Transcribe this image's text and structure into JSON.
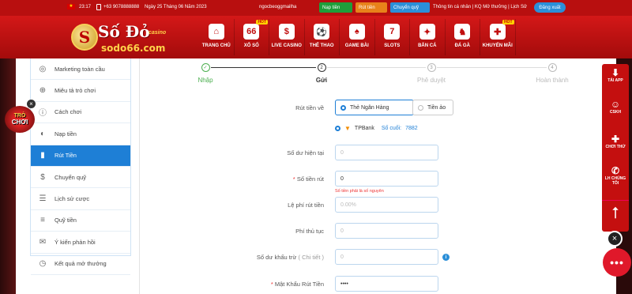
{
  "topbar": {
    "time": "23:17",
    "phone": "+63 9078888888",
    "date": "Ngày 25 Tháng 06 Năm 2023",
    "username": "ngocbeoggmailha",
    "btn_nap": "Nạp tiền",
    "btn_rut": "Rút tiền",
    "btn_chuyen": "Chuyển quỹ",
    "links": "Thông tin cá nhân | KQ Mở thưởng | Lịch Sử",
    "btn_logout": "Đăng xuất"
  },
  "logo": {
    "name": "Số Đỏ",
    "casino": "casino",
    "domain": "sodo66.com"
  },
  "nav": [
    {
      "label": "TRANG CHỦ",
      "icon": "home-icon",
      "glyph": "⌂",
      "hot": ""
    },
    {
      "label": "XỔ SỐ",
      "icon": "lottery-icon",
      "glyph": "66",
      "hot": "HOT"
    },
    {
      "label": "LIVE CASINO",
      "icon": "casino-chip-icon",
      "glyph": "$",
      "hot": ""
    },
    {
      "label": "THỂ THAO",
      "icon": "sports-ball-icon",
      "glyph": "⚽",
      "hot": ""
    },
    {
      "label": "GAME BÀI",
      "icon": "cards-icon",
      "glyph": "♠",
      "hot": ""
    },
    {
      "label": "SLOTS",
      "icon": "slots-icon",
      "glyph": "7",
      "hot": ""
    },
    {
      "label": "BẮN CÁ",
      "icon": "fish-icon",
      "glyph": "✦",
      "hot": ""
    },
    {
      "label": "ĐÁ GÀ",
      "icon": "rooster-icon",
      "glyph": "♞",
      "hot": ""
    },
    {
      "label": "KHUYẾN MÃI",
      "icon": "gift-icon",
      "glyph": "✚",
      "hot": "HOT"
    }
  ],
  "sidebar": [
    {
      "label": "Marketing toàn cầu",
      "icon": "globe-icon",
      "glyph": "◎",
      "active": false
    },
    {
      "label": "Miêu tả trò chơi",
      "icon": "gamepad-icon",
      "glyph": "⊕",
      "active": false
    },
    {
      "label": "Cách chơi",
      "icon": "info-icon",
      "glyph": "ⓘ",
      "active": false
    },
    {
      "label": "Nạp tiền",
      "icon": "piggy-bank-icon",
      "glyph": "◐",
      "active": false
    },
    {
      "label": "Rút Tiền",
      "icon": "withdraw-icon",
      "glyph": "▮",
      "active": true
    },
    {
      "label": "Chuyển quỹ",
      "icon": "transfer-icon",
      "glyph": "$",
      "active": false
    },
    {
      "label": "Lịch sử cược",
      "icon": "history-list-icon",
      "glyph": "☰",
      "active": false
    },
    {
      "label": "Quỹ tiền",
      "icon": "coins-icon",
      "glyph": "≡",
      "active": false
    },
    {
      "label": "Ý kiến phản hồi",
      "icon": "feedback-icon",
      "glyph": "✉",
      "active": false
    },
    {
      "label": "Kết quả mở thưởng",
      "icon": "clock-icon",
      "glyph": "◷",
      "active": false
    }
  ],
  "steps": [
    {
      "num": "✓",
      "label": "Nhập",
      "state": "done"
    },
    {
      "num": "2",
      "label": "Gửi",
      "state": "current"
    },
    {
      "num": "3",
      "label": "Phê duyệt",
      "state": "todo"
    },
    {
      "num": "4",
      "label": "Hoàn thành",
      "state": "todo"
    }
  ],
  "form": {
    "rut_label": "Rút tiền về",
    "opt_bank": "Thẻ Ngân Hàng",
    "opt_crypto": "Tiền ảo",
    "bank_name": "TPBank",
    "acct_label": "Số cuối:",
    "acct_value": "7882",
    "balance_label": "Số dư hiện tại",
    "balance_placeholder": "0",
    "amount_label": "Số tiền rút",
    "amount_value": "0",
    "amount_error": "Số tiền phải là số nguyên",
    "fee_rate_label": "Lệ phí rút tiền",
    "fee_rate_placeholder": "0.00%",
    "fee_label": "Phí thủ tục",
    "fee_placeholder": "0",
    "deduct_label": "Số dư khấu trừ",
    "deduct_detail": "( Chi tiết )",
    "deduct_placeholder": "0",
    "password_label": "Mật Khẩu Rút Tiền",
    "password_value": "••••"
  },
  "right_panel": {
    "app": "TẢI APP",
    "cskh": "CSKH",
    "play": "CHƠI THỬ",
    "contact": "LH CHÚNG TÔI"
  },
  "game_badge": {
    "line1": "TRÒ",
    "line2": "CHƠI"
  },
  "chat_text": "•••",
  "colors": {
    "brand_red": "#c40f0f",
    "accent_blue": "#1e7fd6",
    "success_green": "#4caf50"
  }
}
